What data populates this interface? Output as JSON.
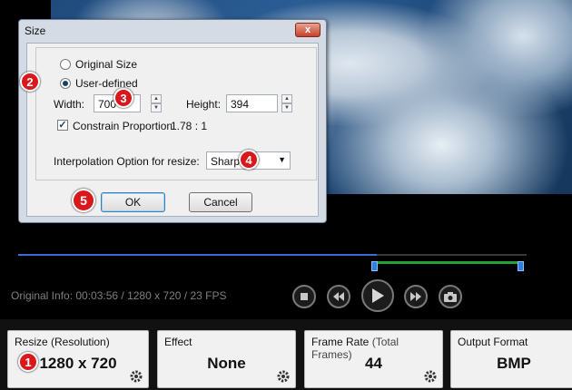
{
  "dialog": {
    "title": "Size",
    "close_glyph": "x",
    "original_size_label": "Original Size",
    "user_defined_label": "User-defined",
    "width_label": "Width:",
    "width_value": "700",
    "height_label": "Height:",
    "height_value": "394",
    "constrain_label": "Constrain Proportion",
    "ratio": "1.78 : 1",
    "interpolation_label": "Interpolation Option for resize:",
    "interpolation_value": "Sharpen",
    "ok_label": "OK",
    "cancel_label": "Cancel",
    "original_size_checked": false,
    "user_defined_checked": true,
    "constrain_checked": true
  },
  "player": {
    "info": "Original Info: 00:03:56 / 1280 x 720 / 23 FPS",
    "progress": 0.705
  },
  "panels": [
    {
      "title": "Resize (Resolution)",
      "subtitle": "",
      "value": "1280 x 720"
    },
    {
      "title": "Effect",
      "subtitle": "",
      "value": "None"
    },
    {
      "title": "Frame Rate",
      "subtitle": "(Total Frames)",
      "value": "44"
    },
    {
      "title": "Output Format",
      "subtitle": "",
      "value": "BMP"
    }
  ],
  "badges": [
    "1",
    "2",
    "3",
    "4",
    "5"
  ],
  "colors": {
    "badge_red": "#d9181b",
    "timeline_blue": "#3b6bd6",
    "trim_green": "#23a438"
  },
  "icons": {
    "controls": [
      "stop-icon",
      "previous-icon",
      "play-icon",
      "next-icon",
      "snapshot-icon"
    ],
    "panel_settings": "gear-icon"
  }
}
